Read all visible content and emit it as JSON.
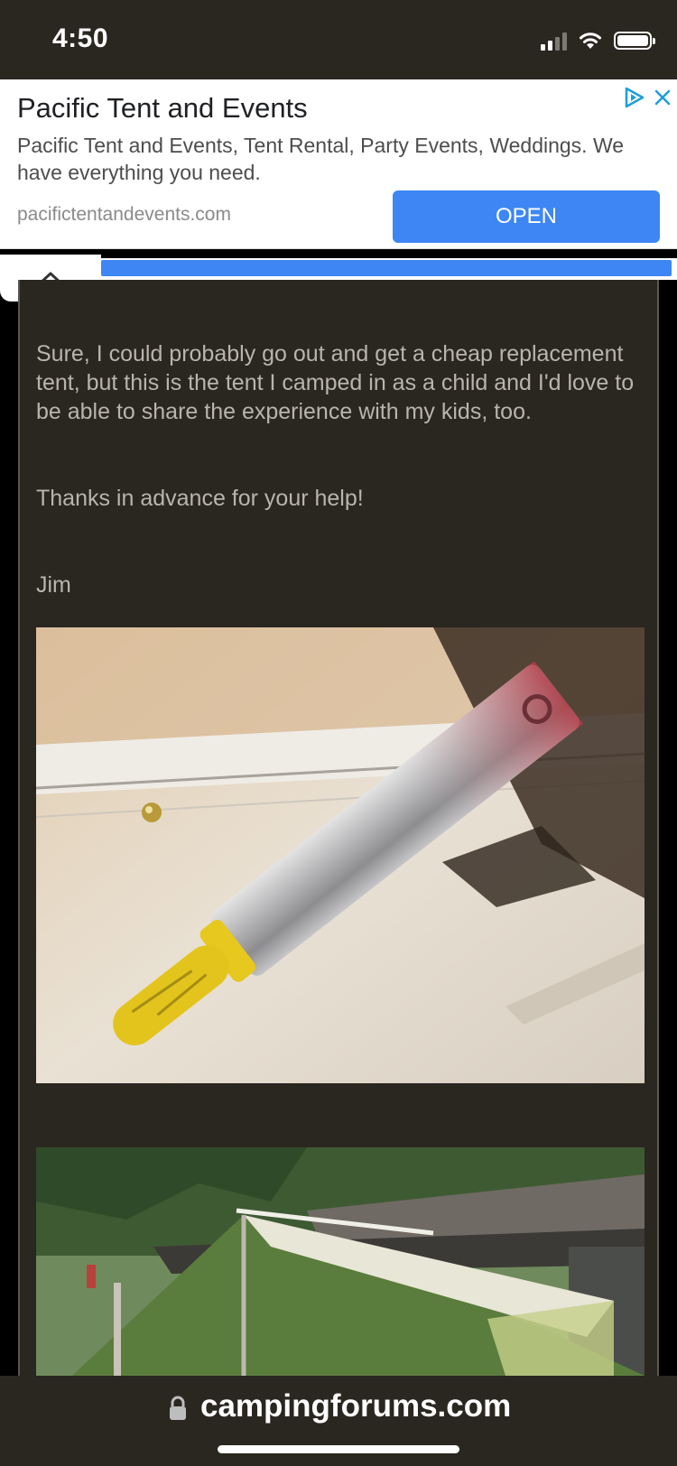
{
  "status_bar": {
    "time": "4:50"
  },
  "ad": {
    "title": "Pacific Tent and Events",
    "description": "Pacific Tent and Events, Tent Rental, Party Events, Weddings. We\nhave everything you need.",
    "url": "pacifictentandevents.com",
    "open_label": "OPEN",
    "accent_color": "#3d86f4"
  },
  "progress": {
    "fraction": 0.99
  },
  "post": {
    "paragraph1": "Sure, I could probably go out and get a cheap replacement tent, but this is the tent I camped in as a child and I'd love to be able to share the experience with my kids, too.",
    "paragraph2": "Thanks in advance for your help!",
    "signature": "Jim"
  },
  "address_bar": {
    "domain": "campingforums.com"
  }
}
